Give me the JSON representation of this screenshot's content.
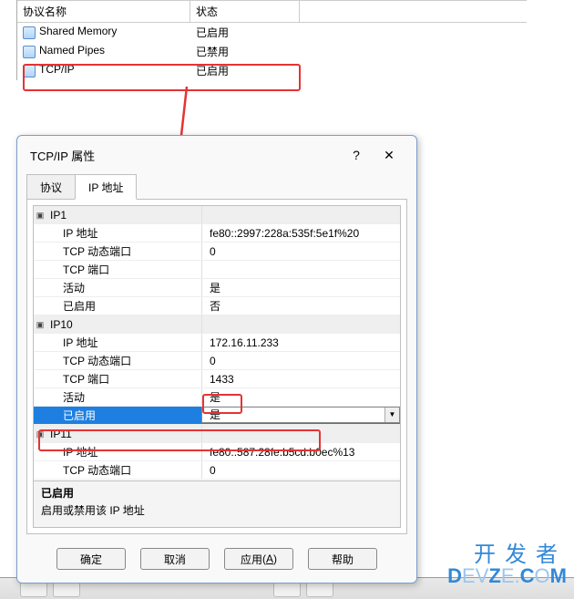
{
  "table": {
    "headers": {
      "name": "协议名称",
      "status": "状态"
    },
    "rows": [
      {
        "name": "Shared Memory",
        "status": "已启用"
      },
      {
        "name": "Named Pipes",
        "status": "已禁用"
      },
      {
        "name": "TCP/IP",
        "status": "已启用"
      }
    ]
  },
  "dialog": {
    "title": "TCP/IP 属性",
    "help_glyph": "?",
    "close_glyph": "✕",
    "tabs": {
      "protocol": "协议",
      "ip_addresses": "IP 地址"
    },
    "groups": [
      {
        "name": "IP1",
        "props": [
          {
            "label": "IP 地址",
            "value": "fe80::2997:228a:535f:5e1f%20"
          },
          {
            "label": "TCP 动态端口",
            "value": "0"
          },
          {
            "label": "TCP 端口",
            "value": ""
          },
          {
            "label": "活动",
            "value": "是"
          },
          {
            "label": "已启用",
            "value": "否"
          }
        ]
      },
      {
        "name": "IP10",
        "props": [
          {
            "label": "IP 地址",
            "value": "172.16.11.233"
          },
          {
            "label": "TCP 动态端口",
            "value": "0"
          },
          {
            "label": "TCP 端口",
            "value": "1433"
          },
          {
            "label": "活动",
            "value": "是"
          },
          {
            "label": "已启用",
            "value": "是",
            "selected": true
          }
        ]
      },
      {
        "name": "IP11",
        "props": [
          {
            "label": "IP 地址",
            "value": "fe80::587:28fe:b5cd:b0ec%13"
          },
          {
            "label": "TCP 动态端口",
            "value": "0"
          }
        ]
      }
    ],
    "description": {
      "title": "已启用",
      "body": "启用或禁用该 IP 地址"
    },
    "buttons": {
      "ok": "确定",
      "cancel": "取消",
      "apply": "应用",
      "apply_hotkey": "A",
      "help": "帮助"
    }
  },
  "watermark": {
    "cn": "开发者",
    "en_dark": "D",
    "en_light1": "EV",
    "en_dark2": "Z",
    "en_light2": "E.",
    "en_dark3": "C",
    "en_light3": "O",
    "en_dark4": "M"
  }
}
